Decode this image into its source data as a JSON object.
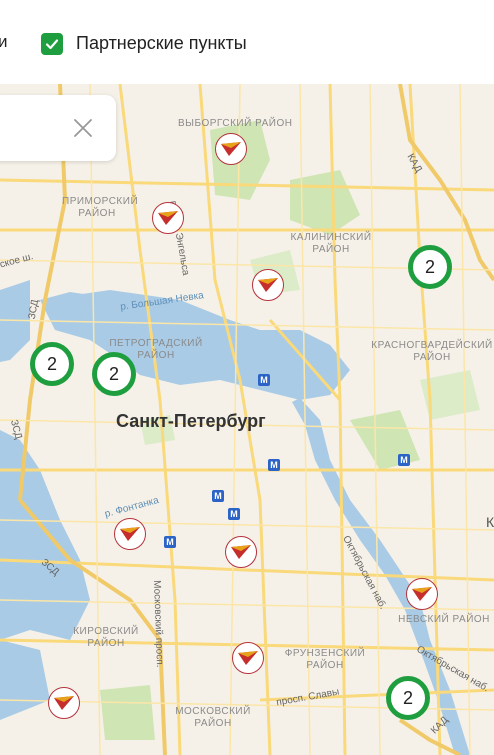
{
  "filters": {
    "prev_label_fragment": "и",
    "partner_label": "Партнерские пункты",
    "partner_checked": true
  },
  "search": {
    "clear_icon": "close-icon"
  },
  "map": {
    "city": "Санкт-Петербург",
    "districts": [
      "ВЫБОРГСКИЙ РАЙОН",
      "ПРИМОРСКИЙ РАЙОН",
      "КАЛИНИНСКИЙ РАЙОН",
      "ПЕТРОГРАДСКИЙ РАЙОН",
      "КРАСНОГВАРДЕЙСКИЙ РАЙОН",
      "КИРОВСКИЙ РАЙОН",
      "НЕВСКИЙ РАЙОН",
      "ФРУНЗЕНСКИЙ РАЙОН",
      "МОСКОВСКИЙ РАЙОН"
    ],
    "roads": [
      "просп. Энгельса",
      "КАД",
      "ЗСД",
      "ЗСД",
      "ЗСД",
      "рское ш.",
      "Московский просп.",
      "Октябрьская наб.",
      "Октябрьская наб.",
      "просп. Славы",
      "КАД"
    ],
    "waters": [
      "р. Большая Невка",
      "р. Фонтанка"
    ],
    "edge_letter": "К",
    "clusters": [
      "2",
      "2",
      "2",
      "2"
    ],
    "pin_icon": "partner-logo-icon",
    "metro_icon": "metro-icon",
    "colors": {
      "cluster_ring": "#1e9e3f",
      "pin_border": "#b5323a",
      "water": "#a9cbe6",
      "road": "#f9d97a"
    }
  }
}
